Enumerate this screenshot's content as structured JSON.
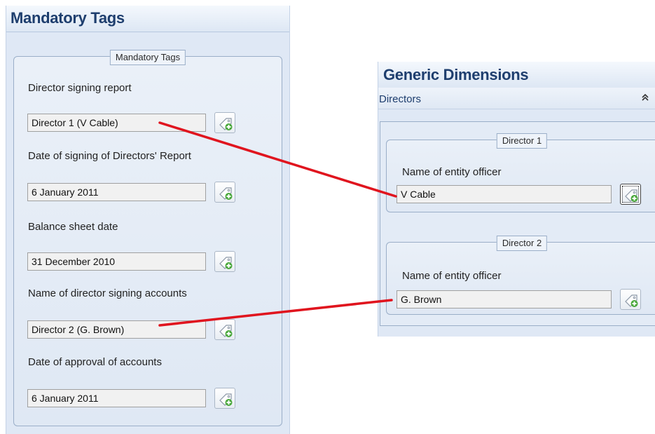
{
  "mandatory_panel": {
    "title": "Mandatory Tags",
    "group_legend": "Mandatory Tags",
    "fields": [
      {
        "label": "Director signing report",
        "value": "Director 1 (V Cable)"
      },
      {
        "label": "Date of signing of Directors' Report",
        "value": "6 January 2011"
      },
      {
        "label": "Balance sheet date",
        "value": "31 December 2010"
      },
      {
        "label": "Name of director signing accounts",
        "value": "Director 2 (G. Brown)"
      },
      {
        "label": "Date of approval of accounts",
        "value": "6 January 2011"
      }
    ]
  },
  "generic_panel": {
    "title": "Generic Dimensions",
    "section": "Directors",
    "groups": [
      {
        "legend": "Director 1",
        "label": "Name of entity officer",
        "value": "V Cable"
      },
      {
        "legend": "Director 2",
        "label": "Name of entity officer",
        "value": "G. Brown"
      }
    ]
  },
  "icons": {
    "tag_button": "tag-add-icon",
    "collapse": "double-chevron-up-icon"
  },
  "colors": {
    "panel_background": "#dfe8f5",
    "title_text": "#1e3e6e",
    "annotation_arrow": "#e0141e"
  }
}
